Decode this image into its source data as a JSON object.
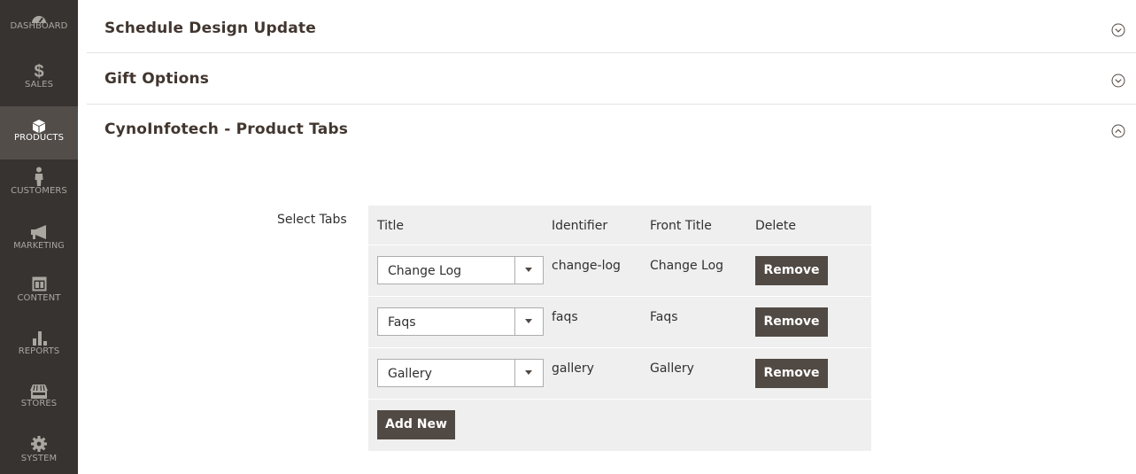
{
  "sidebar": {
    "items": [
      {
        "label": "DASHBOARD",
        "icon": "dashboard-icon"
      },
      {
        "label": "SALES",
        "icon": "dollar-icon"
      },
      {
        "label": "PRODUCTS",
        "icon": "cube-icon",
        "active": true
      },
      {
        "label": "CUSTOMERS",
        "icon": "person-icon"
      },
      {
        "label": "MARKETING",
        "icon": "megaphone-icon"
      },
      {
        "label": "CONTENT",
        "icon": "layout-icon"
      },
      {
        "label": "REPORTS",
        "icon": "bar-chart-icon"
      },
      {
        "label": "STORES",
        "icon": "storefront-icon"
      },
      {
        "label": "SYSTEM",
        "icon": "gear-icon"
      }
    ]
  },
  "sections": [
    {
      "title": "Schedule Design Update",
      "state": "collapsed"
    },
    {
      "title": "Gift Options",
      "state": "collapsed"
    },
    {
      "title": "CynoInfotech - Product Tabs",
      "state": "expanded"
    }
  ],
  "product_tabs": {
    "field_label": "Select Tabs",
    "headers": {
      "title": "Title",
      "identifier": "Identifier",
      "front_title": "Front Title",
      "delete": "Delete"
    },
    "rows": [
      {
        "title": "Change Log",
        "identifier": "change-log",
        "front_title": "Change Log",
        "remove_label": "Remove"
      },
      {
        "title": "Faqs",
        "identifier": "faqs",
        "front_title": "Faqs",
        "remove_label": "Remove"
      },
      {
        "title": "Gallery",
        "identifier": "gallery",
        "front_title": "Gallery",
        "remove_label": "Remove"
      }
    ],
    "add_label": "Add New"
  },
  "colors": {
    "sidebar_bg": "#373330",
    "sidebar_active_bg": "#524d49",
    "button_dark": "#514943",
    "grid_bg": "#efefef"
  }
}
